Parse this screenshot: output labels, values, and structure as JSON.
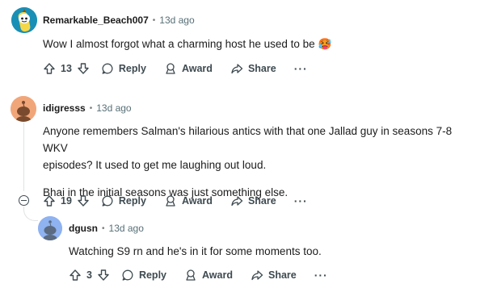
{
  "comments": [
    {
      "author": "Remarkable_Beach007",
      "time": "13d ago",
      "body": [
        "Wow I almost forgot what a charming host he used to be"
      ],
      "emoji": "🥵",
      "votes": "13",
      "reply_label": "Reply",
      "award_label": "Award",
      "share_label": "Share",
      "more_label": "···"
    },
    {
      "author": "idigresss",
      "time": "13d ago",
      "body": [
        "Anyone remembers Salman's hilarious antics with that one Jallad guy in seasons 7-8 WKV",
        "episodes? It used to get me laughing out loud.",
        "Bhai in the initial seasons was just something else."
      ],
      "votes": "19",
      "reply_label": "Reply",
      "award_label": "Award",
      "share_label": "Share",
      "more_label": "···"
    },
    {
      "author": "dgusn",
      "time": "13d ago",
      "body": [
        "Watching S9 rn and he's in it for some moments too."
      ],
      "votes": "3",
      "reply_label": "Reply",
      "award_label": "Award",
      "share_label": "Share",
      "more_label": "···"
    }
  ],
  "separator": "•",
  "colors": {
    "text": "#1c1c1c",
    "meta": "#576f76",
    "action": "#3e4a50",
    "thread_line": "#dfe2e4",
    "avatar_1_bg": "#1a8fb6",
    "avatar_2_bg": "#f1a67a",
    "avatar_3_bg": "#8fb2f0"
  }
}
